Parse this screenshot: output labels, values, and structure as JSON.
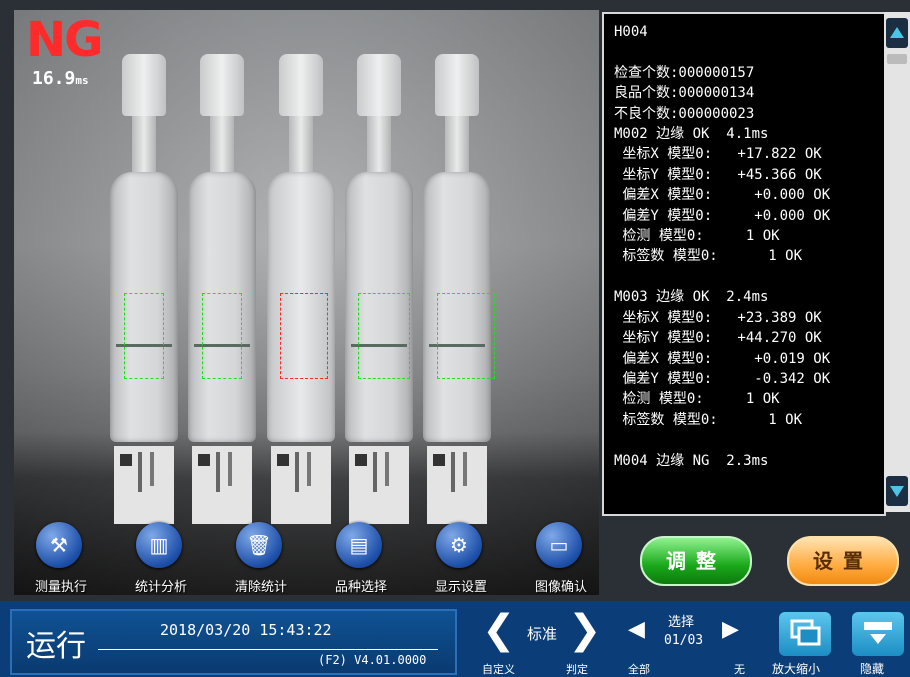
{
  "camera": {
    "result": "NG",
    "time": "16.9",
    "time_unit": "ms",
    "rois": [
      "ok",
      "ok",
      "ng",
      "ok",
      "ok"
    ]
  },
  "panel": {
    "lines": [
      "H004",
      "",
      "检查个数:000000157",
      "良品个数:000000134",
      "不良个数:000000023",
      "M002 边缘 OK  4.1ms",
      " 坐标X 模型0:   +17.822 OK",
      " 坐标Y 模型0:   +45.366 OK",
      " 偏差X 模型0:     +0.000 OK",
      " 偏差Y 模型0:     +0.000 OK",
      " 检测 模型0:     1 OK",
      " 标签数 模型0:      1 OK",
      "",
      "M003 边缘 OK  2.4ms",
      " 坐标X 模型0:   +23.389 OK",
      " 坐标Y 模型0:   +44.270 OK",
      " 偏差X 模型0:     +0.019 OK",
      " 偏差Y 模型0:     -0.342 OK",
      " 检测 模型0:     1 OK",
      " 标签数 模型0:      1 OK",
      "",
      "M004 边缘 NG  2.3ms"
    ]
  },
  "toolbar": [
    {
      "label": "测量执行",
      "icon": "measure-icon"
    },
    {
      "label": "统计分析",
      "icon": "chart-icon"
    },
    {
      "label": "清除统计",
      "icon": "clear-icon"
    },
    {
      "label": "品种选择",
      "icon": "product-icon"
    },
    {
      "label": "显示设置",
      "icon": "display-settings-icon"
    },
    {
      "label": "图像确认",
      "icon": "image-confirm-icon"
    }
  ],
  "buttons": {
    "adjust": "调整",
    "settings": "设置"
  },
  "status": {
    "mode": "运行",
    "datetime": "2018/03/20 15:43:22",
    "version": "(F2) V4.01.0000",
    "judge_mode": "标准",
    "left_label": "自定义",
    "right_label": "判定",
    "select_title": "选择",
    "select_page": "01/03",
    "select_left": "全部",
    "select_right": "无",
    "zoom": "放大缩小",
    "hide": "隐藏"
  }
}
